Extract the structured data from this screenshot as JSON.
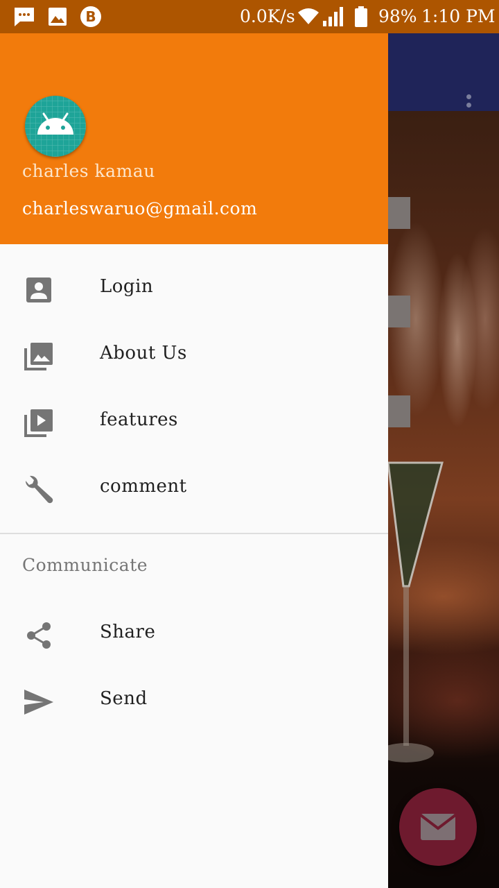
{
  "status_bar": {
    "net_speed": "0.0K/s",
    "battery": "98%",
    "time": "1:10 PM",
    "icons": [
      "message-icon",
      "image-icon",
      "bitcoin-icon",
      "wifi-icon",
      "signal-icon",
      "battery-icon"
    ]
  },
  "drawer": {
    "header": {
      "avatar_icon": "android-icon",
      "name": "charles kamau",
      "email": "charleswaruo@gmail.com",
      "color": "#f27b0c"
    },
    "items": [
      {
        "label": "Login",
        "icon": "account-box-icon"
      },
      {
        "label": "About Us",
        "icon": "photo-library-icon"
      },
      {
        "label": "features",
        "icon": "video-library-icon"
      },
      {
        "label": "comment",
        "icon": "wrench-icon"
      }
    ],
    "section": {
      "title": "Communicate",
      "items": [
        {
          "label": "Share",
          "icon": "share-icon"
        },
        {
          "label": "Send",
          "icon": "send-icon"
        }
      ]
    }
  },
  "background": {
    "toolbar_color": "#1f2459",
    "overflow_icon": "more-vert-icon",
    "fab_icon": "email-icon",
    "fab_color": "#6e1a2e"
  }
}
